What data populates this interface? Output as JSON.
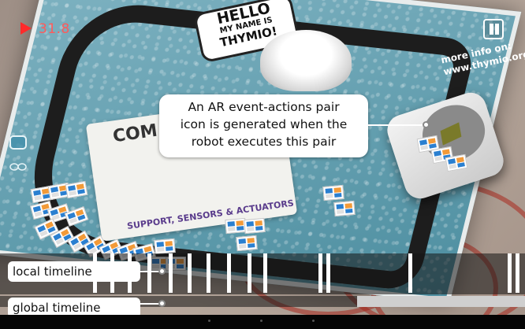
{
  "hud": {
    "time": "31.8",
    "play_icon": "play-triangle-icon",
    "pause_icon": "pause-icon"
  },
  "scene": {
    "speech_line1": "HELLO",
    "speech_line2": "MY NAME IS",
    "speech_line3": "THYMIO!",
    "card_title": "COM",
    "card_footer": "SUPPORT, SENSORS & ACTUATORS",
    "more_info": "more info on:",
    "more_info_url": "www.thymio.org"
  },
  "callout": {
    "line1": "An AR event-actions pair",
    "line2": "icon is generated when the",
    "line3": "robot executes this pair"
  },
  "timeline": {
    "local_label": "local timeline",
    "global_label": "global timeline",
    "global_progress": 0.32
  },
  "colors": {
    "accent_red": "#ff2a2a",
    "pair_blue": "#2a7fd0",
    "pair_orange": "#f29a38"
  }
}
